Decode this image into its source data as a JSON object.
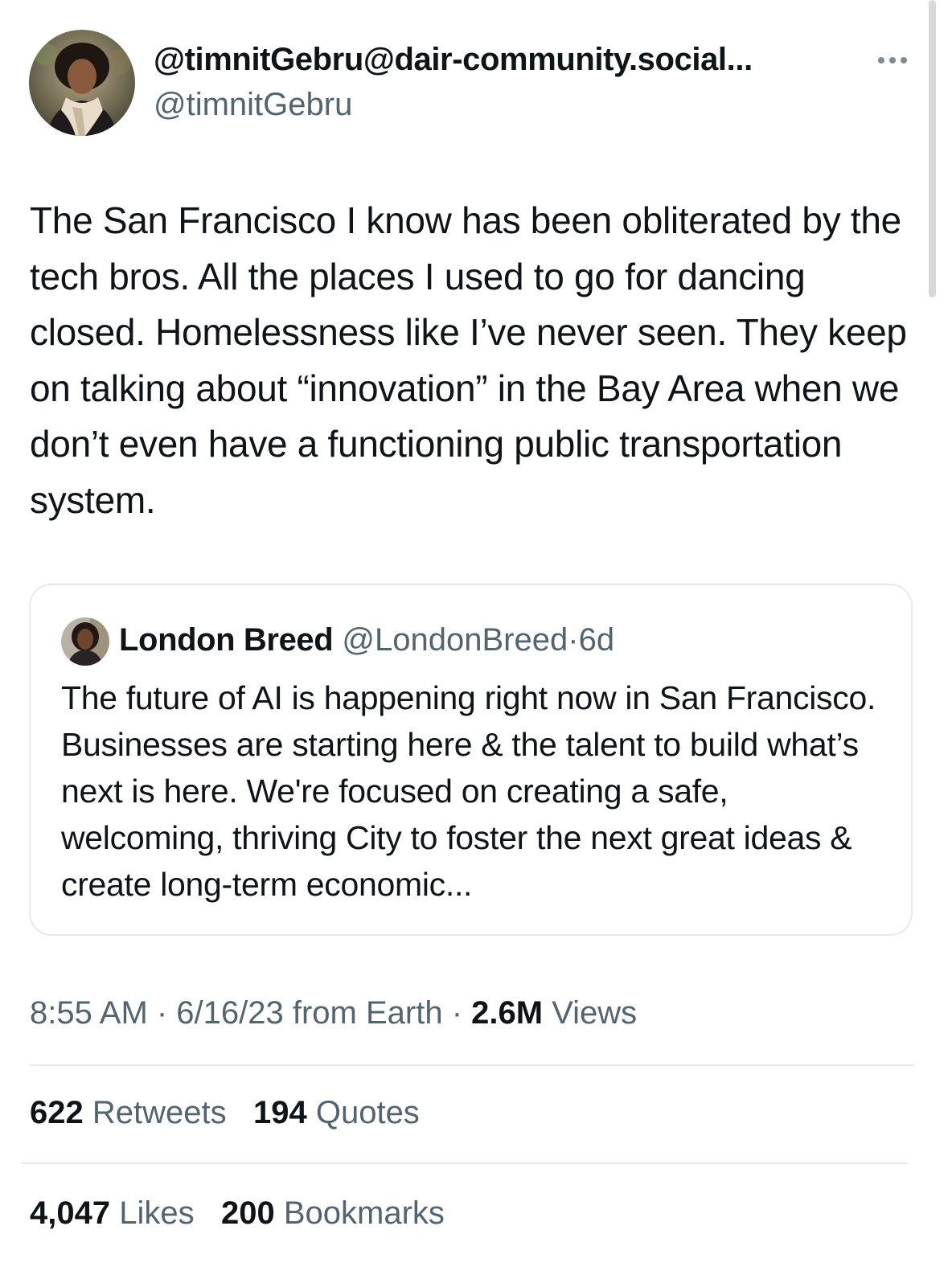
{
  "author": {
    "display_name": "@timnitGebru@dair-community.social...",
    "handle": "@timnitGebru"
  },
  "tweet": {
    "text": "The San Francisco I know has been obliterated by the tech bros. All the places I used to go for dancing closed. Homelessness like I’ve never seen. They keep on talking about “innovation” in the Bay Area when we don’t even have a functioning public transportation system."
  },
  "quoted": {
    "name": "London Breed",
    "handle": "@LondonBreed",
    "separator": "·",
    "time": "6d",
    "text": "The future of AI is happening right now in San Francisco. Businesses are starting here & the talent to build what’s next is here. We're focused on creating a safe, welcoming, thriving City to foster the next great ideas & create long-term economic..."
  },
  "meta": {
    "time_date": "8:55 AM · 6/16/23 from Earth · ",
    "views_count": "2.6M",
    "views_label": " Views"
  },
  "stats": {
    "retweets_count": "622",
    "retweets_label": "Retweets",
    "quotes_count": "194",
    "quotes_label": "Quotes",
    "likes_count": "4,047",
    "likes_label": "Likes",
    "bookmarks_count": "200",
    "bookmarks_label": "Bookmarks"
  },
  "icons": {
    "more": "more-horizontal-icon"
  },
  "colors": {
    "text_primary": "#0f1419",
    "text_secondary": "#536471",
    "border": "#e6e9eb"
  }
}
